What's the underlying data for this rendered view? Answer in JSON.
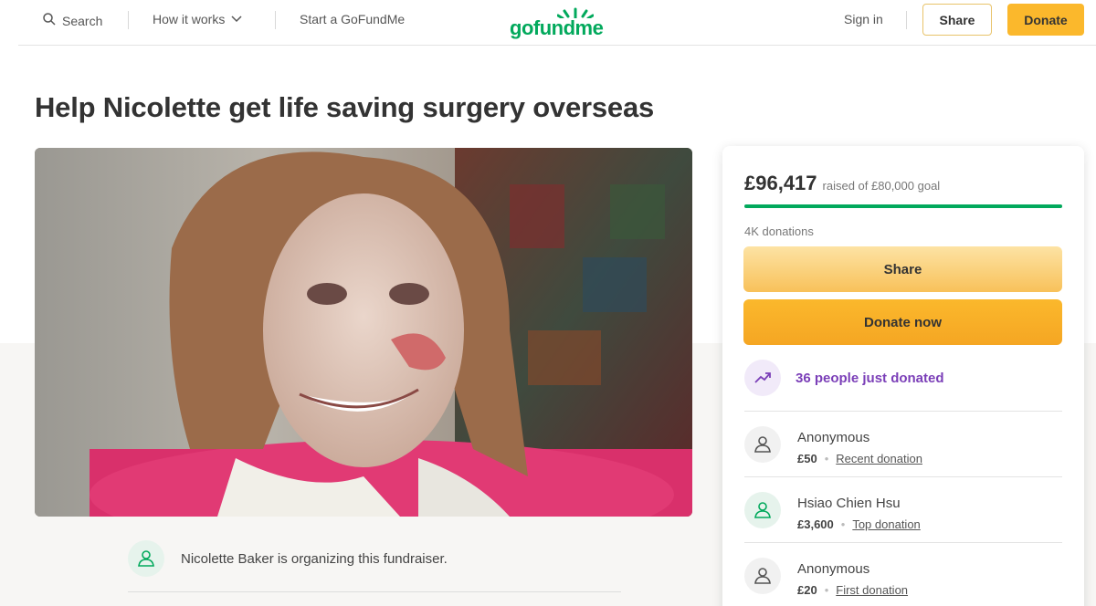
{
  "header": {
    "search_label": "Search",
    "how_it_works_label": "How it works",
    "start_label": "Start a GoFundMe",
    "logo_text": "gofundme",
    "sign_in_label": "Sign in",
    "share_label": "Share",
    "donate_label": "Donate"
  },
  "campaign": {
    "title": "Help Nicolette get life saving surgery overseas",
    "organizer_text": "Nicolette Baker is organizing this fundraiser."
  },
  "donation_card": {
    "raised_amount": "£96,417",
    "goal_text": "raised of £80,000 goal",
    "progress_fraction": 1.0,
    "donations_count": "4K donations",
    "share_label": "Share",
    "donate_now_label": "Donate now",
    "trend_text": "36 people just donated",
    "donors": [
      {
        "name": "Anonymous",
        "amount": "£50",
        "tag": "Recent donation"
      },
      {
        "name": "Hsiao Chien Hsu",
        "amount": "£3,600",
        "tag": "Top donation"
      },
      {
        "name": "Anonymous",
        "amount": "£20",
        "tag": "First donation"
      }
    ]
  },
  "colors": {
    "brand_green": "#02a95c",
    "donate_yellow": "#fbb82c",
    "trend_purple": "#7b3fb8"
  },
  "icons": {
    "search": "search-icon",
    "chevron": "chevron-down-icon",
    "trend": "trending-up-icon",
    "person": "person-heart-icon"
  }
}
